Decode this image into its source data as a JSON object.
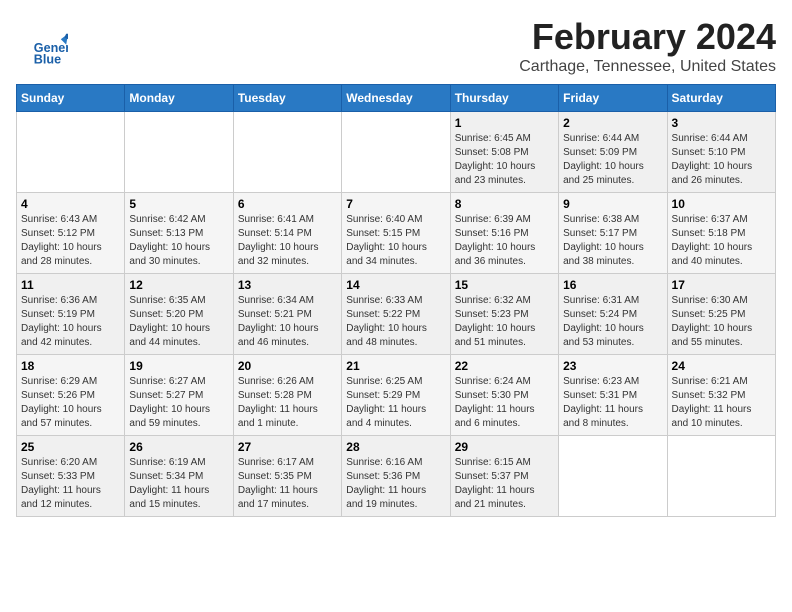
{
  "app": {
    "name": "GeneralBlue",
    "logo_line1": "General",
    "logo_line2": "Blue"
  },
  "header": {
    "month_year": "February 2024",
    "location": "Carthage, Tennessee, United States"
  },
  "weekdays": [
    "Sunday",
    "Monday",
    "Tuesday",
    "Wednesday",
    "Thursday",
    "Friday",
    "Saturday"
  ],
  "weeks": [
    [
      {
        "day": "",
        "info": ""
      },
      {
        "day": "",
        "info": ""
      },
      {
        "day": "",
        "info": ""
      },
      {
        "day": "",
        "info": ""
      },
      {
        "day": "1",
        "info": "Sunrise: 6:45 AM\nSunset: 5:08 PM\nDaylight: 10 hours\nand 23 minutes."
      },
      {
        "day": "2",
        "info": "Sunrise: 6:44 AM\nSunset: 5:09 PM\nDaylight: 10 hours\nand 25 minutes."
      },
      {
        "day": "3",
        "info": "Sunrise: 6:44 AM\nSunset: 5:10 PM\nDaylight: 10 hours\nand 26 minutes."
      }
    ],
    [
      {
        "day": "4",
        "info": "Sunrise: 6:43 AM\nSunset: 5:12 PM\nDaylight: 10 hours\nand 28 minutes."
      },
      {
        "day": "5",
        "info": "Sunrise: 6:42 AM\nSunset: 5:13 PM\nDaylight: 10 hours\nand 30 minutes."
      },
      {
        "day": "6",
        "info": "Sunrise: 6:41 AM\nSunset: 5:14 PM\nDaylight: 10 hours\nand 32 minutes."
      },
      {
        "day": "7",
        "info": "Sunrise: 6:40 AM\nSunset: 5:15 PM\nDaylight: 10 hours\nand 34 minutes."
      },
      {
        "day": "8",
        "info": "Sunrise: 6:39 AM\nSunset: 5:16 PM\nDaylight: 10 hours\nand 36 minutes."
      },
      {
        "day": "9",
        "info": "Sunrise: 6:38 AM\nSunset: 5:17 PM\nDaylight: 10 hours\nand 38 minutes."
      },
      {
        "day": "10",
        "info": "Sunrise: 6:37 AM\nSunset: 5:18 PM\nDaylight: 10 hours\nand 40 minutes."
      }
    ],
    [
      {
        "day": "11",
        "info": "Sunrise: 6:36 AM\nSunset: 5:19 PM\nDaylight: 10 hours\nand 42 minutes."
      },
      {
        "day": "12",
        "info": "Sunrise: 6:35 AM\nSunset: 5:20 PM\nDaylight: 10 hours\nand 44 minutes."
      },
      {
        "day": "13",
        "info": "Sunrise: 6:34 AM\nSunset: 5:21 PM\nDaylight: 10 hours\nand 46 minutes."
      },
      {
        "day": "14",
        "info": "Sunrise: 6:33 AM\nSunset: 5:22 PM\nDaylight: 10 hours\nand 48 minutes."
      },
      {
        "day": "15",
        "info": "Sunrise: 6:32 AM\nSunset: 5:23 PM\nDaylight: 10 hours\nand 51 minutes."
      },
      {
        "day": "16",
        "info": "Sunrise: 6:31 AM\nSunset: 5:24 PM\nDaylight: 10 hours\nand 53 minutes."
      },
      {
        "day": "17",
        "info": "Sunrise: 6:30 AM\nSunset: 5:25 PM\nDaylight: 10 hours\nand 55 minutes."
      }
    ],
    [
      {
        "day": "18",
        "info": "Sunrise: 6:29 AM\nSunset: 5:26 PM\nDaylight: 10 hours\nand 57 minutes."
      },
      {
        "day": "19",
        "info": "Sunrise: 6:27 AM\nSunset: 5:27 PM\nDaylight: 10 hours\nand 59 minutes."
      },
      {
        "day": "20",
        "info": "Sunrise: 6:26 AM\nSunset: 5:28 PM\nDaylight: 11 hours\nand 1 minute."
      },
      {
        "day": "21",
        "info": "Sunrise: 6:25 AM\nSunset: 5:29 PM\nDaylight: 11 hours\nand 4 minutes."
      },
      {
        "day": "22",
        "info": "Sunrise: 6:24 AM\nSunset: 5:30 PM\nDaylight: 11 hours\nand 6 minutes."
      },
      {
        "day": "23",
        "info": "Sunrise: 6:23 AM\nSunset: 5:31 PM\nDaylight: 11 hours\nand 8 minutes."
      },
      {
        "day": "24",
        "info": "Sunrise: 6:21 AM\nSunset: 5:32 PM\nDaylight: 11 hours\nand 10 minutes."
      }
    ],
    [
      {
        "day": "25",
        "info": "Sunrise: 6:20 AM\nSunset: 5:33 PM\nDaylight: 11 hours\nand 12 minutes."
      },
      {
        "day": "26",
        "info": "Sunrise: 6:19 AM\nSunset: 5:34 PM\nDaylight: 11 hours\nand 15 minutes."
      },
      {
        "day": "27",
        "info": "Sunrise: 6:17 AM\nSunset: 5:35 PM\nDaylight: 11 hours\nand 17 minutes."
      },
      {
        "day": "28",
        "info": "Sunrise: 6:16 AM\nSunset: 5:36 PM\nDaylight: 11 hours\nand 19 minutes."
      },
      {
        "day": "29",
        "info": "Sunrise: 6:15 AM\nSunset: 5:37 PM\nDaylight: 11 hours\nand 21 minutes."
      },
      {
        "day": "",
        "info": ""
      },
      {
        "day": "",
        "info": ""
      }
    ]
  ]
}
